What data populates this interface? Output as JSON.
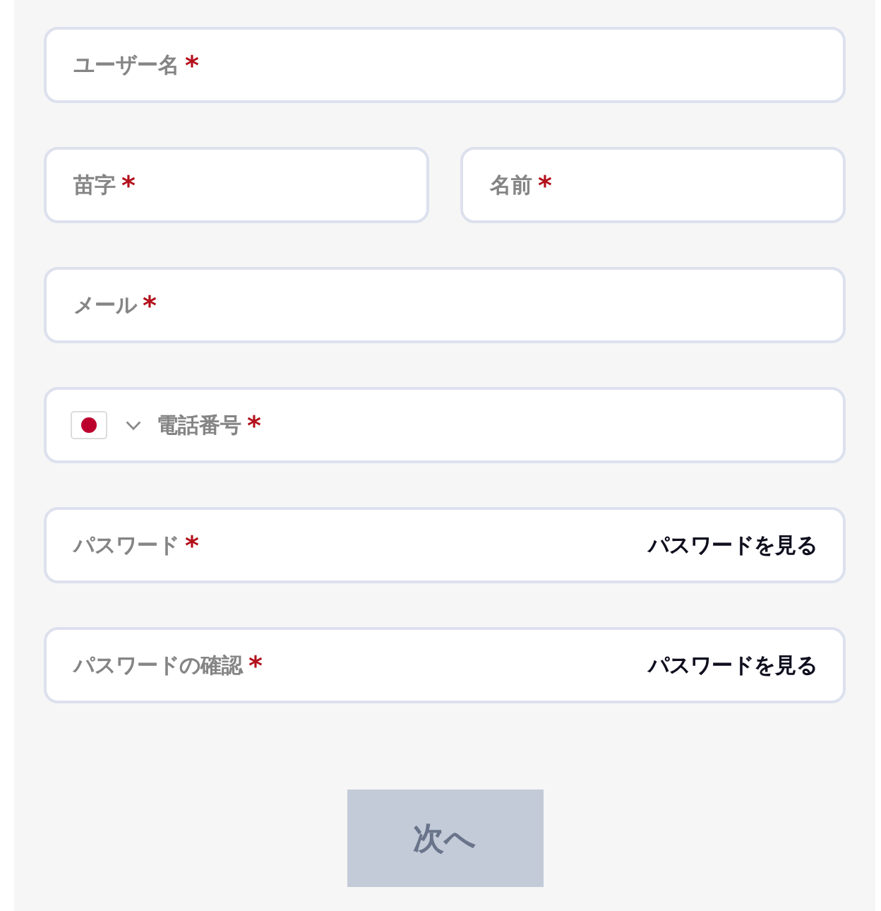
{
  "form": {
    "rows": [
      {
        "fields": [
          {
            "kind": "text",
            "label": "ユーザー名",
            "required_mark": "*"
          }
        ]
      },
      {
        "fields": [
          {
            "kind": "text",
            "label": "苗字",
            "required_mark": "*"
          },
          {
            "kind": "text",
            "label": "名前",
            "required_mark": "*"
          }
        ]
      },
      {
        "fields": [
          {
            "kind": "email",
            "label": "メール",
            "required_mark": "*"
          }
        ]
      },
      {
        "fields": [
          {
            "kind": "phone",
            "label": "電話番号",
            "required_mark": "*"
          }
        ]
      },
      {
        "fields": [
          {
            "kind": "password",
            "label": "パスワード",
            "required_mark": "*",
            "toggle": "パスワードを見る"
          }
        ]
      },
      {
        "fields": [
          {
            "kind": "password",
            "label": "パスワードの確認",
            "required_mark": "*",
            "toggle": "パスワードを見る"
          }
        ]
      }
    ]
  },
  "next_button": {
    "label": "次へ",
    "disabled": true
  }
}
